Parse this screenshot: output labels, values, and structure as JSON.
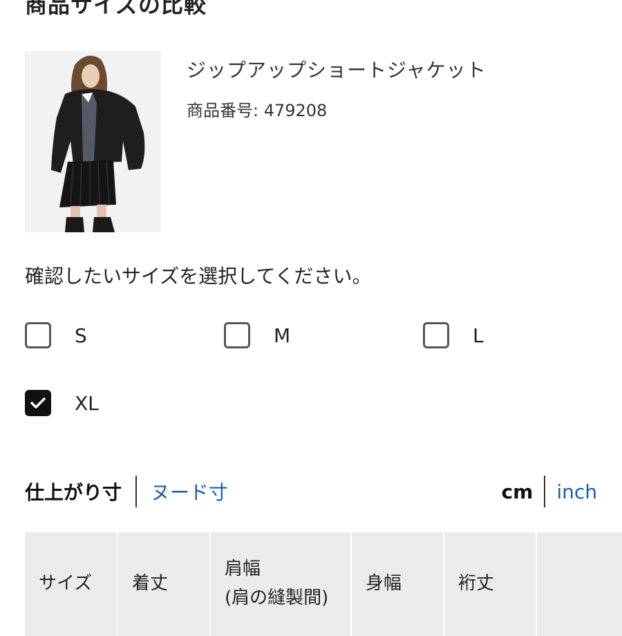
{
  "page": {
    "heading": "商品サイズの比較"
  },
  "product": {
    "name": "ジップアップショートジャケット",
    "number": "商品番号: 479208",
    "image_alt": "model wearing black zip-up short jacket with pleated skirt"
  },
  "size_selector": {
    "instruction": "確認したいサイズを選択してください。",
    "options": [
      {
        "label": "S",
        "checked": false
      },
      {
        "label": "M",
        "checked": false
      },
      {
        "label": "L",
        "checked": false
      },
      {
        "label": "XL",
        "checked": true
      }
    ]
  },
  "measure_toggle": {
    "active": "仕上がり寸",
    "other": "ヌード寸"
  },
  "unit_toggle": {
    "active": "cm",
    "other": "inch"
  },
  "table": {
    "headers": [
      {
        "line1": "サイズ",
        "line2": ""
      },
      {
        "line1": "着丈",
        "line2": ""
      },
      {
        "line1": "肩幅",
        "line2": "(肩の縫製間)"
      },
      {
        "line1": "身幅",
        "line2": ""
      },
      {
        "line1": "裄丈",
        "line2": ""
      },
      {
        "line1": "",
        "line2": ""
      }
    ]
  },
  "colors": {
    "link": "#1a5ea8",
    "checkbox_checked": "#111111",
    "table_header_bg": "#ebebeb"
  }
}
